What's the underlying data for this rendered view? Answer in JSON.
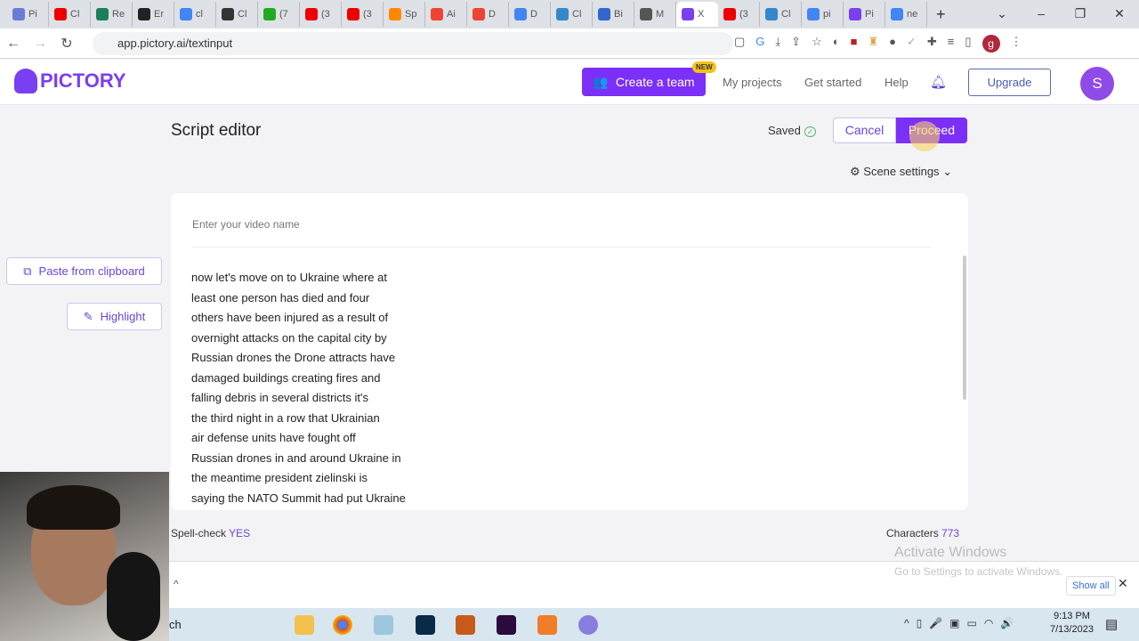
{
  "browser": {
    "tabs": [
      "Pi",
      "Cl",
      "Re",
      "Er",
      "cl",
      "Cl",
      "(7",
      "(3",
      "(3",
      "Sp",
      "Ai",
      "D",
      "D",
      "Cl",
      "Bi",
      "M",
      "X",
      "(3",
      "Cl",
      "pi",
      "Pi",
      "ne"
    ],
    "url": "app.pictory.ai/textinput",
    "profile_initial": "g"
  },
  "header": {
    "logo": "PICTORY",
    "create_team": "Create a team",
    "new_badge": "NEW",
    "my_projects": "My projects",
    "get_started": "Get started",
    "help": "Help",
    "upgrade": "Upgrade",
    "avatar_initial": "S"
  },
  "editor": {
    "title": "Script editor",
    "saved": "Saved",
    "cancel": "Cancel",
    "proceed": "Proceed",
    "scene_settings": "Scene settings",
    "video_name_placeholder": "Enter your video name",
    "script_lines": [
      "now let's move on to Ukraine where at",
      "least one person has died and four",
      "others have been injured as a result of",
      "overnight attacks on the capital city by",
      "Russian drones the Drone attracts have",
      "damaged buildings creating fires and",
      "falling debris in several districts it's",
      "the third night in a row that Ukrainian",
      "air defense units have fought off",
      "Russian drones in and around Ukraine in",
      "the meantime president zielinski is",
      "saying the NATO Summit had put Ukraine"
    ],
    "paste_clipboard": "Paste from clipboard",
    "highlight": "Highlight",
    "spellcheck_label": "Spell-check",
    "spellcheck_value": "YES",
    "characters_label": "Characters",
    "characters_value": "773"
  },
  "os": {
    "activate_title": "Activate Windows",
    "activate_sub": "Go to Settings to activate Windows.",
    "show_all": "Show all",
    "search_fragment": "ch",
    "time": "9:13 PM",
    "date": "7/13/2023"
  },
  "colors": {
    "accent": "#7b2ff7",
    "text_accent": "#6a45d8"
  }
}
